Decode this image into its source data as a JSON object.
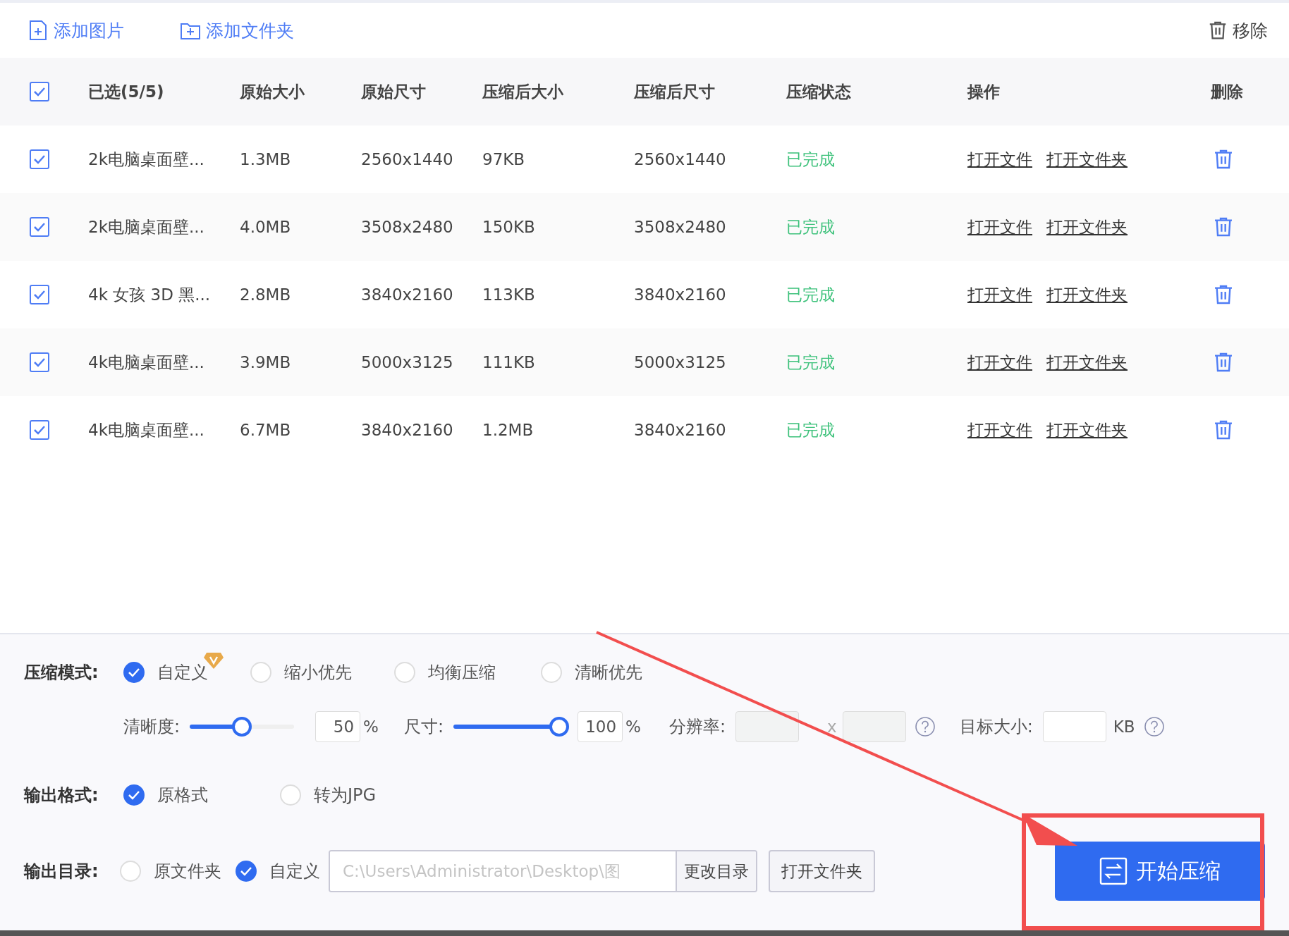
{
  "toolbar": {
    "add_image": "添加图片",
    "add_folder": "添加文件夹",
    "remove": "移除"
  },
  "table": {
    "all_checked": true,
    "columns": [
      "已选(5/5)",
      "原始大小",
      "原始尺寸",
      "压缩后大小",
      "压缩后尺寸",
      "压缩状态",
      "操作",
      "删除"
    ],
    "rows": [
      {
        "checked": true,
        "name": "2k电脑桌面壁...",
        "original_size": "1.3MB",
        "original_dimensions": "2560x1440",
        "compressed_size": "97KB",
        "compressed_dimensions": "2560x1440",
        "status": "已完成",
        "actions": [
          "打开文件",
          "打开文件夹"
        ]
      },
      {
        "checked": true,
        "name": "2k电脑桌面壁...",
        "original_size": "4.0MB",
        "original_dimensions": "3508x2480",
        "compressed_size": "150KB",
        "compressed_dimensions": "3508x2480",
        "status": "已完成",
        "actions": [
          "打开文件",
          "打开文件夹"
        ]
      },
      {
        "checked": true,
        "name": "4k 女孩 3D 黑...",
        "original_size": "2.8MB",
        "original_dimensions": "3840x2160",
        "compressed_size": "113KB",
        "compressed_dimensions": "3840x2160",
        "status": "已完成",
        "actions": [
          "打开文件",
          "打开文件夹"
        ]
      },
      {
        "checked": true,
        "name": "4k电脑桌面壁...",
        "original_size": "3.9MB",
        "original_dimensions": "5000x3125",
        "compressed_size": "111KB",
        "compressed_dimensions": "5000x3125",
        "status": "已完成",
        "actions": [
          "打开文件",
          "打开文件夹"
        ]
      },
      {
        "checked": true,
        "name": "4k电脑桌面壁...",
        "original_size": "6.7MB",
        "original_dimensions": "3840x2160",
        "compressed_size": "1.2MB",
        "compressed_dimensions": "3840x2160",
        "status": "已完成",
        "actions": [
          "打开文件",
          "打开文件夹"
        ]
      }
    ]
  },
  "settings": {
    "mode": {
      "label": "压缩模式:",
      "options": [
        {
          "label": "自定义",
          "selected": true,
          "vip": true
        },
        {
          "label": "缩小优先",
          "selected": false,
          "vip": false
        },
        {
          "label": "均衡压缩",
          "selected": false,
          "vip": false
        },
        {
          "label": "清晰优先",
          "selected": false,
          "vip": false
        }
      ]
    },
    "clarity": {
      "label": "清晰度:",
      "level": 0.5,
      "value": "50",
      "unit": "%"
    },
    "size": {
      "label": "尺寸:",
      "level": 1,
      "value": "100",
      "unit": "%"
    },
    "resolution": {
      "label": "分辨率:",
      "separator": "x",
      "disabled": true
    },
    "target_size": {
      "label": "目标大小:",
      "unit": "KB"
    },
    "format": {
      "label": "输出格式:",
      "options": [
        {
          "label": "原格式",
          "selected": true
        },
        {
          "label": "转为JPG",
          "selected": false
        }
      ]
    },
    "output_dir": {
      "label": "输出目录:",
      "options": [
        {
          "label": "原文件夹",
          "selected": false
        },
        {
          "label": "自定义",
          "selected": true
        }
      ],
      "path": "C:\\Users\\Administrator\\Desktop\\图",
      "change_button": "更改目录",
      "open_button": "打开文件夹"
    },
    "start_button": "开始压缩"
  }
}
